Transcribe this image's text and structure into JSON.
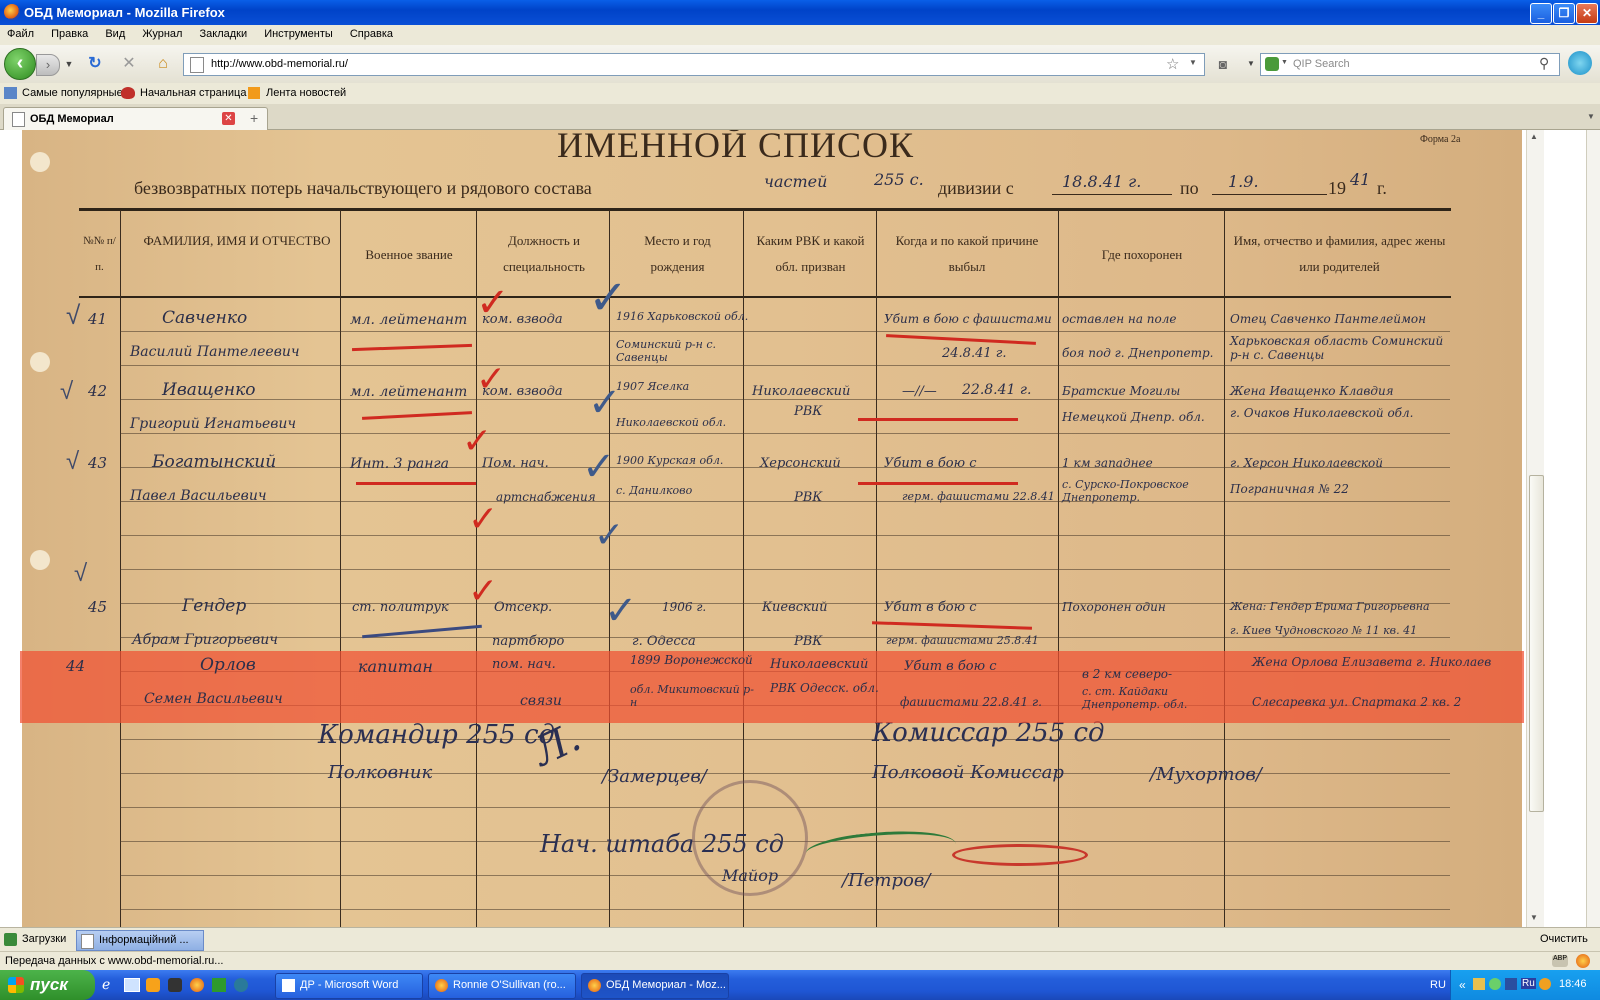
{
  "window": {
    "title": "ОБД Мемориал - Mozilla Firefox"
  },
  "menu": [
    "Файл",
    "Правка",
    "Вид",
    "Журнал",
    "Закладки",
    "Инструменты",
    "Справка"
  ],
  "nav": {
    "url": "http://www.obd-memorial.ru/",
    "search_placeholder": "QIP Search"
  },
  "bookmarks": [
    "Самые популярные",
    "Начальная страница",
    "Лента новостей"
  ],
  "tabs": [
    {
      "label": "ОБД Мемориал"
    }
  ],
  "document": {
    "form_label": "Форма 2а",
    "heading": "ИМЕННОЙ СПИСОК",
    "subtitle_prefix": "безвозвратных потерь начальствующего и рядового состава",
    "subtitle_unit_hand": "частей",
    "subtitle_num_hand": "255 с.",
    "subtitle_div": "дивизии с",
    "date_from": "18.8.41 г.",
    "date_to_label": "по",
    "date_to": "1.9.",
    "year_prefix": "19",
    "year_hand": "41",
    "year_suffix": "г.",
    "columns": [
      "№№ п/п.",
      "ФАМИЛИЯ, ИМЯ И ОТЧЕСТВО",
      "Военное звание",
      "Должность и специальность",
      "Место и год рождения",
      "Каким РВК и какой обл. призван",
      "Когда и по какой причине выбыл",
      "Где похоронен",
      "Имя, отчество и фамилия, адрес жены или родителей"
    ],
    "rows": [
      {
        "num": "41",
        "name1": "Савченко",
        "name2": "Василий Пантелеевич",
        "rank": "мл. лейтенант",
        "post1": "ком. взвода",
        "post2": "",
        "birth1": "1916 Харьковской обл.",
        "birth2": "Соминский р-н с. Савенцы",
        "rvk1": "",
        "rvk2": "",
        "when1": "Убит в бою с фашистами",
        "when2": "24.8.41 г.",
        "buried1": "оставлен на поле",
        "buried2": "боя под г. Днепропетр.",
        "family1": "Отец Савченко Пантелеймон",
        "family2": "Харьковская область Соминский р-н с. Савенцы"
      },
      {
        "num": "42",
        "name1": "Иващенко",
        "name2": "Григорий Игнатьевич",
        "rank": "мл. лейтенант",
        "post1": "ком. взвода",
        "post2": "",
        "birth1": "1907 Яселка",
        "birth2": "Николаевской обл.",
        "rvk1": "Николаевский",
        "rvk2": "РВК",
        "when1": "—//—",
        "when2": "22.8.41 г.",
        "buried1": "Братские Могилы",
        "buried2": "Немецкой Днепр. обл.",
        "family1": "Жена Иващенко Клавдия",
        "family2": "г. Очаков Николаевской обл."
      },
      {
        "num": "43",
        "name1": "Богатынский",
        "name2": "Павел Васильевич",
        "rank": "Инт. 3 ранга",
        "post1": "Пом. нач.",
        "post2": "артснабжения",
        "birth1": "1900 Курская обл.",
        "birth2": "с. Данилково",
        "rvk1": "Херсонский",
        "rvk2": "РВК",
        "when1": "Убит в бою с",
        "when2": "герм. фашистами 22.8.41",
        "buried1": "1 км западнее",
        "buried2": "с. Сурско-Покровское Днепропетр.",
        "family1": "г. Херсон Николаевской",
        "family2": "Пограничная № 22"
      },
      {
        "num": "44",
        "name1": "Орлов",
        "name2": "Семен Васильевич",
        "rank": "капитан",
        "post1": "пом. нач.",
        "post2": "связи",
        "birth1": "1899 Воронежской",
        "birth2": "обл. Микитовский р-н",
        "rvk1": "Николаевский",
        "rvk2": "РВК Одесск. обл.",
        "when1": "Убит в бою с",
        "when2": "фашистами 22.8.41 г.",
        "buried1": "в 2 км северо-",
        "buried2": "с. ст. Кайдаки Днепропетр. обл.",
        "family1": "Жена Орлова Елизавета г. Николаев",
        "family2": "Слесаревка ул. Спартака 2 кв. 2"
      },
      {
        "num": "45",
        "name1": "Гендер",
        "name2": "Абрам Григорьевич",
        "rank": "ст. политрук",
        "post1": "Отсекр.",
        "post2": "партбюро",
        "birth1": "1906 г.",
        "birth2": "г. Одесса",
        "rvk1": "Киевский",
        "rvk2": "РВК",
        "when1": "Убит в бою с",
        "when2": "герм. фашистами 25.8.41",
        "buried1": "Похоронен один",
        "buried2": "",
        "family1": "Жена: Гендер Ерима Григорьевна",
        "family2": "г. Киев Чудновского № 11 кв. 41"
      }
    ],
    "signatures": {
      "commander_line": "Командир 255 сд",
      "commander_rank": "Полковник",
      "commander_name": "/Замерцев/",
      "commissar_line": "Комиссар 255 сд",
      "commissar_rank": "Полковой Комиссар",
      "commissar_name": "/Мухортов/",
      "chief_line": "Нач. штаба 255 сд",
      "chief_rank": "Майор",
      "chief_name": "/Петров/"
    }
  },
  "downloads": {
    "label": "Загрузки",
    "tab": "Інформаційний ..."
  },
  "clear_label": "Очистить",
  "status_text": "Передача данных с www.obd-memorial.ru...",
  "taskbar": {
    "start": "пуск",
    "tasks": [
      "ДР - Microsoft Word",
      "Ronnie O'Sullivan (ro...",
      "ОБД Мемориал - Moz..."
    ],
    "lang": "RU",
    "tray_lang": "Ru",
    "clock": "18:46"
  }
}
